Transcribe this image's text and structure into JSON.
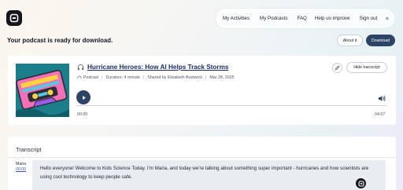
{
  "nav": {
    "items": [
      "My Activities",
      "My Podcasts",
      "FAQ",
      "Help us improve",
      "Sign out"
    ]
  },
  "banner": {
    "message": "Your podcast is ready for download.",
    "about_label": "About it",
    "download_label": "Download"
  },
  "podcast": {
    "title": "Hurricane Heroes: How AI Helps Track Storms",
    "type": "Podcast",
    "duration": "Duration: 4 minute",
    "shared_by": "Shared by Elisabeth Bostwick",
    "date": "Mar 28, 2025",
    "hide_transcript_label": "Hide transcript",
    "current_time": "00:00",
    "total_time": "04:07",
    "progress": 0.0
  },
  "transcript": {
    "heading": "Transcript",
    "entries": [
      {
        "speaker": "Maria",
        "timestamp": "00:00",
        "text": "Hello everyone! Welcome to Kids Science Today. I'm Maria, and today we're talking about something super important - hurricanes and how scientists are using cool technology to keep people safe."
      }
    ]
  },
  "colors": {
    "primary": "#2d4466",
    "title": "#1d2e63",
    "link": "#3b58c4"
  }
}
